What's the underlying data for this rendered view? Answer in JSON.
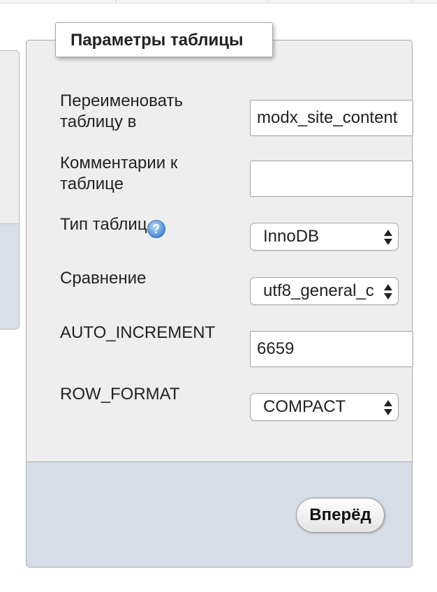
{
  "panel": {
    "legend": "Параметры таблицы"
  },
  "fields": {
    "rename": {
      "label": "Переименовать таблицу в",
      "value": "modx_site_content"
    },
    "comments": {
      "label": "Комментарии к таблице",
      "value": ""
    },
    "type": {
      "label": "Тип таблиц",
      "help_icon": "help-icon",
      "help_glyph": "?",
      "value": "InnoDB"
    },
    "collation": {
      "label": "Сравнение",
      "value": "utf8_general_c"
    },
    "auto_increment": {
      "label": "AUTO_INCREMENT",
      "value": "6659"
    },
    "row_format": {
      "label": "ROW_FORMAT",
      "value": "COMPACT"
    }
  },
  "footer": {
    "submit_label": "Вперёд"
  },
  "colors": {
    "panel_background": "#eeeeee",
    "footer_background": "#d6dde6",
    "help_icon_blue": "#5f9de0"
  }
}
